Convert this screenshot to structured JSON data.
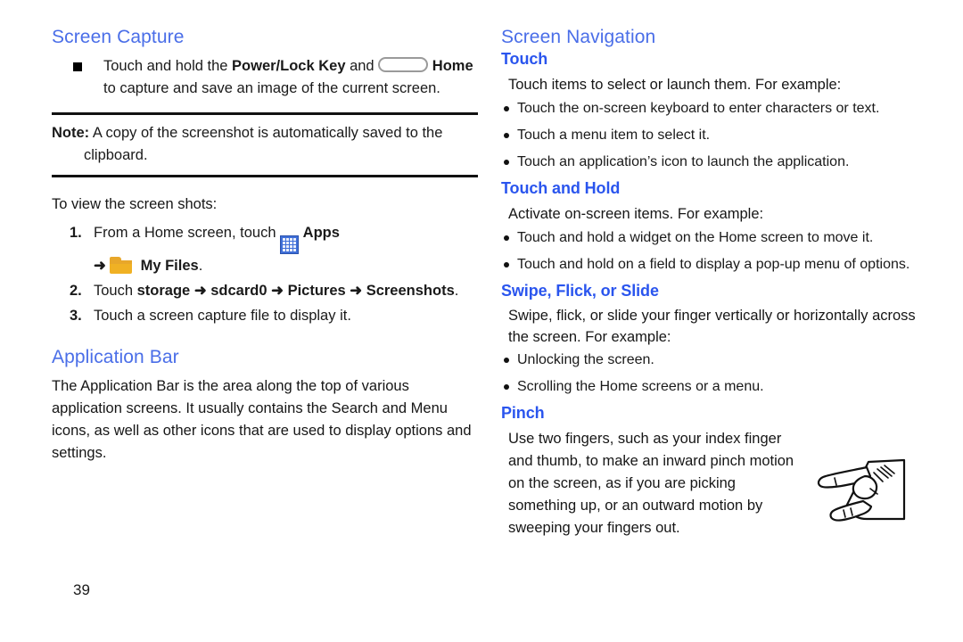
{
  "page": {
    "number": "39"
  },
  "left_column": {
    "screen_capture": {
      "title": "Screen Capture",
      "bullet": {
        "part1": "Touch and hold the ",
        "bold1": "Power/Lock Key",
        "part2": " and ",
        "home_key_icon": "home-key-icon",
        "bold2": "Home",
        "line2": "to capture and save an image of the current screen."
      },
      "note": {
        "label": "Note:",
        "text": " A copy of the screenshot is automatically saved to the",
        "continuation": "clipboard."
      },
      "intro": "To view the screen shots:",
      "steps": [
        {
          "num": "1.",
          "part1": "From a Home screen, touch ",
          "apps_icon": "apps-grid-icon",
          "bold1": "Apps",
          "arrow": "➜",
          "folder_icon": "folder-icon",
          "bold2": "My Files",
          "tail": "."
        },
        {
          "num": "2.",
          "part1": "Touch ",
          "b1": "storage",
          "a1": "➜",
          "b2": "sdcard0",
          "a2": "➜",
          "b3": "Pictures",
          "a3": "➜",
          "b4": "Screenshots",
          "tail": "."
        },
        {
          "num": "3.",
          "text": "Touch a screen capture file to display it."
        }
      ]
    },
    "application_bar": {
      "title": "Application Bar",
      "body": "The Application Bar is the area along the top of various application screens. It usually contains the Search and Menu icons, as well as other icons that are used to display options and settings."
    }
  },
  "right_column": {
    "screen_navigation": {
      "title": "Screen Navigation",
      "subsections": [
        {
          "heading": "Touch",
          "intro": "Touch items to select or launch them. For example:",
          "bullets": [
            "Touch the on-screen keyboard to enter characters or text.",
            "Touch a menu item to select it.",
            "Touch an application’s icon to launch the application."
          ]
        },
        {
          "heading": "Touch and Hold",
          "intro": "Activate on-screen items. For example:",
          "bullets": [
            "Touch and hold a widget on the Home screen to move it.",
            "Touch and hold on a field to display a pop-up menu of options."
          ]
        },
        {
          "heading": "Swipe, Flick, or Slide",
          "intro": "Swipe, flick, or slide your finger vertically or horizontally across the screen. For example:",
          "bullets": [
            "Unlocking the screen.",
            "Scrolling the Home screens or a menu."
          ]
        },
        {
          "heading": "Pinch",
          "intro": "Use two fingers, such as your index finger and thumb, to make an inward pinch motion on the screen, as if you are picking something up, or an outward motion by sweeping your fingers out.",
          "bullets": []
        }
      ],
      "illustration": "pinch-hand-illustration"
    }
  },
  "colors": {
    "section_heading": "#4a6ee8",
    "sub_heading": "#2a55ee",
    "body_text": "#161616",
    "rule": "#111111",
    "apps_icon": "#3f6fd8",
    "folder_icon": "#f0b124"
  }
}
